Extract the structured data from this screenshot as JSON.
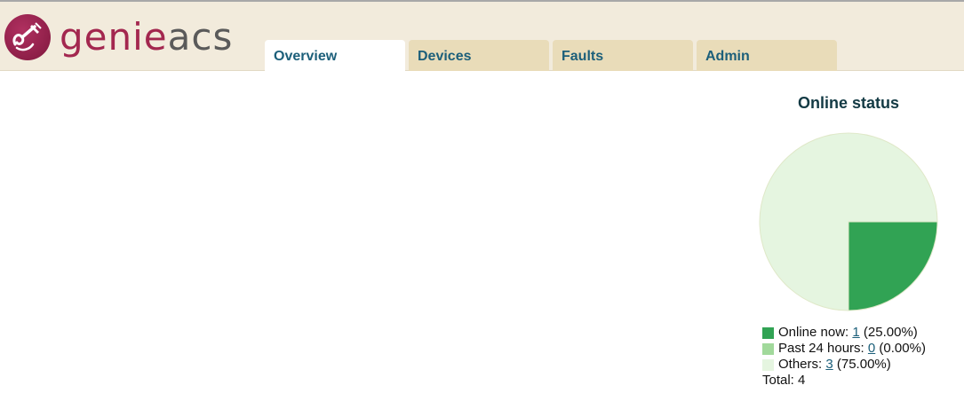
{
  "app": {
    "logo_genie": "genie",
    "logo_acs": "acs"
  },
  "tabs": [
    {
      "label": "Overview",
      "active": true
    },
    {
      "label": "Devices",
      "active": false
    },
    {
      "label": "Faults",
      "active": false
    },
    {
      "label": "Admin",
      "active": false
    }
  ],
  "chart_data": {
    "type": "pie",
    "title": "Online status",
    "slices": [
      {
        "label": "Online now",
        "value": 1,
        "percent": "25.00%",
        "color": "#31a354"
      },
      {
        "label": "Past 24 hours",
        "value": 0,
        "percent": "0.00%",
        "color": "#a1d99b"
      },
      {
        "label": "Others",
        "value": 3,
        "percent": "75.00%",
        "color": "#e5f5e0"
      }
    ],
    "total_label": "Total:",
    "total": 4
  },
  "legend": {
    "online_label": "Online now:",
    "online_count": "1",
    "online_pct": "(25.00%)",
    "past_label": "Past 24 hours:",
    "past_count": "0",
    "past_pct": "(0.00%)",
    "others_label": "Others:",
    "others_count": "3",
    "others_pct": "(75.00%)",
    "total_text": "Total: 4"
  },
  "colors": {
    "header_bg": "#f2ebdc",
    "tab_bg": "#e9dcb9",
    "tab_text": "#1c5f7a",
    "brand": "#a3274f"
  }
}
